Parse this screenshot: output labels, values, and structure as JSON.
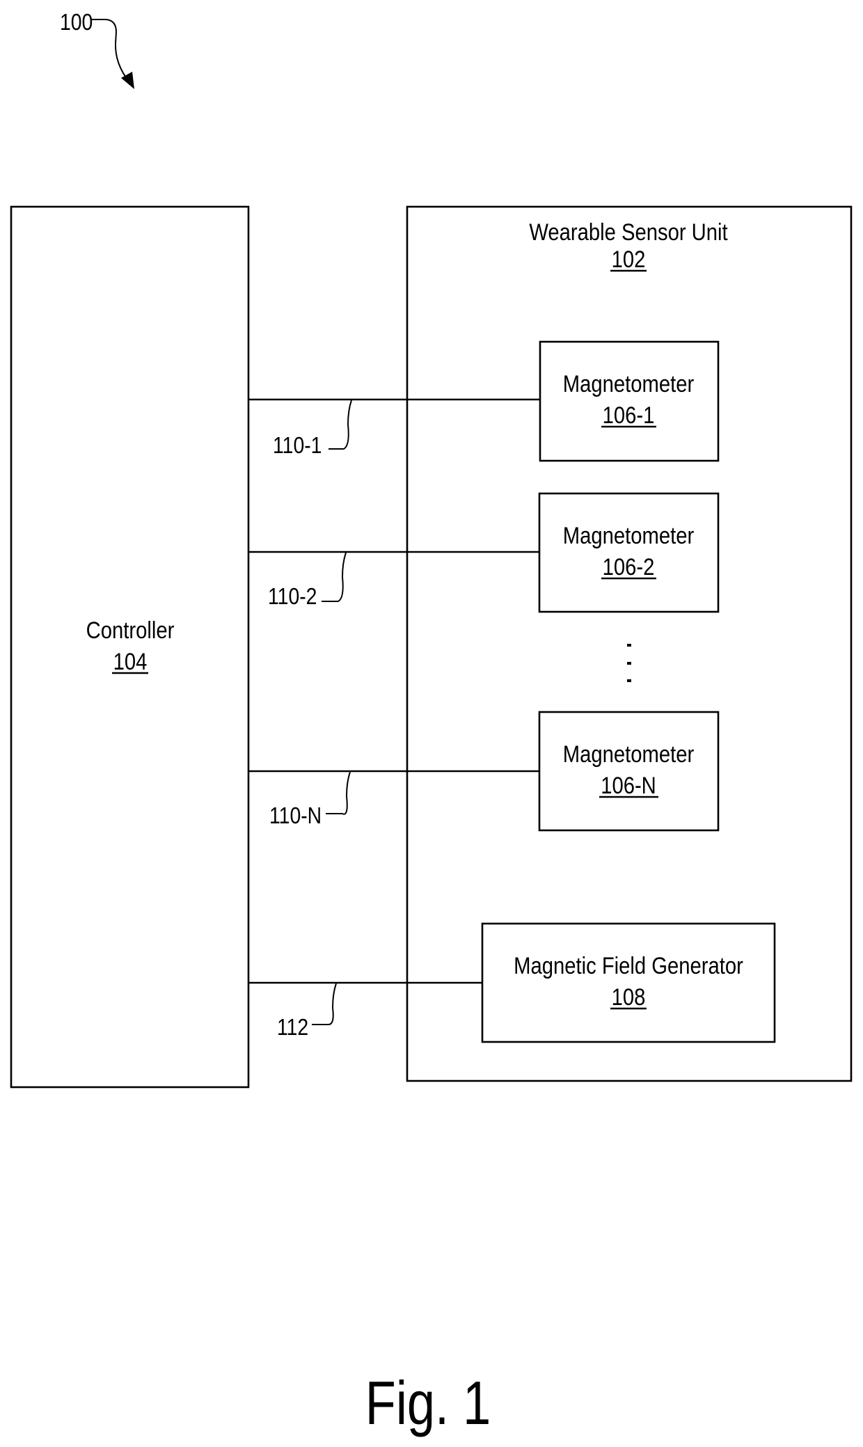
{
  "figure": {
    "reference_label": "100",
    "caption": "Fig. 1",
    "colors": {
      "stroke": "#000000",
      "background": "#ffffff"
    }
  },
  "blocks": {
    "controller": {
      "title": "Controller",
      "ref": "104"
    },
    "wearable_sensor_unit": {
      "title": "Wearable Sensor Unit",
      "ref": "102"
    },
    "magnetometers": [
      {
        "title": "Magnetometer",
        "ref": "106-1"
      },
      {
        "title": "Magnetometer",
        "ref": "106-2"
      },
      {
        "title": "Magnetometer",
        "ref": "106-N"
      }
    ],
    "magnetic_field_generator": {
      "title": "Magnetic Field Generator",
      "ref": "108"
    }
  },
  "connections": [
    {
      "label": "110-1",
      "from": "Controller 104",
      "to": "Magnetometer 106-1"
    },
    {
      "label": "110-2",
      "from": "Controller 104",
      "to": "Magnetometer 106-2"
    },
    {
      "label": "110-N",
      "from": "Controller 104",
      "to": "Magnetometer 106-N"
    },
    {
      "label": "112",
      "from": "Controller 104",
      "to": "Magnetic Field Generator 108"
    }
  ],
  "ellipsis": "⋮"
}
